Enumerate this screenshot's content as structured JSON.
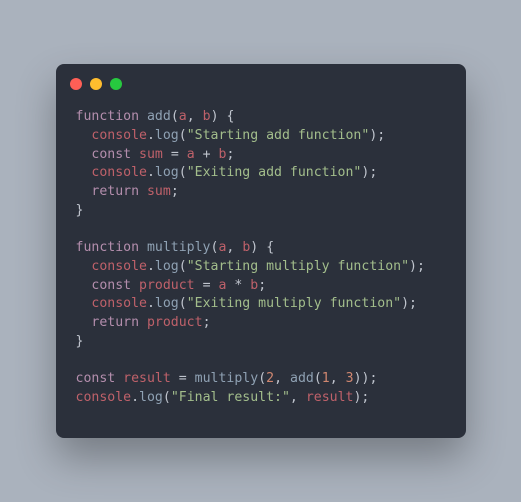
{
  "window": {
    "dots": [
      "red",
      "yellow",
      "green"
    ]
  },
  "tokens": {
    "kw_function": "function",
    "kw_const": "const",
    "kw_return": "return",
    "fn_add": "add",
    "fn_multiply": "multiply",
    "fn_log": "log",
    "obj_console": "console",
    "param_a": "a",
    "param_b": "b",
    "var_sum": "sum",
    "var_product": "product",
    "var_result": "result",
    "str_start_add": "\"Starting add function\"",
    "str_exit_add": "\"Exiting add function\"",
    "str_start_mult": "\"Starting multiply function\"",
    "str_exit_mult": "\"Exiting multiply function\"",
    "str_final": "\"Final result:\"",
    "num_2": "2",
    "num_1": "1",
    "num_3": "3",
    "op_plus": "+",
    "op_star": "*",
    "op_eq": "=",
    "p_open": "(",
    "p_close": ")",
    "p_obrace": "{",
    "p_cbrace": "}",
    "p_comma": ",",
    "p_semi": ";",
    "p_dot": "."
  }
}
